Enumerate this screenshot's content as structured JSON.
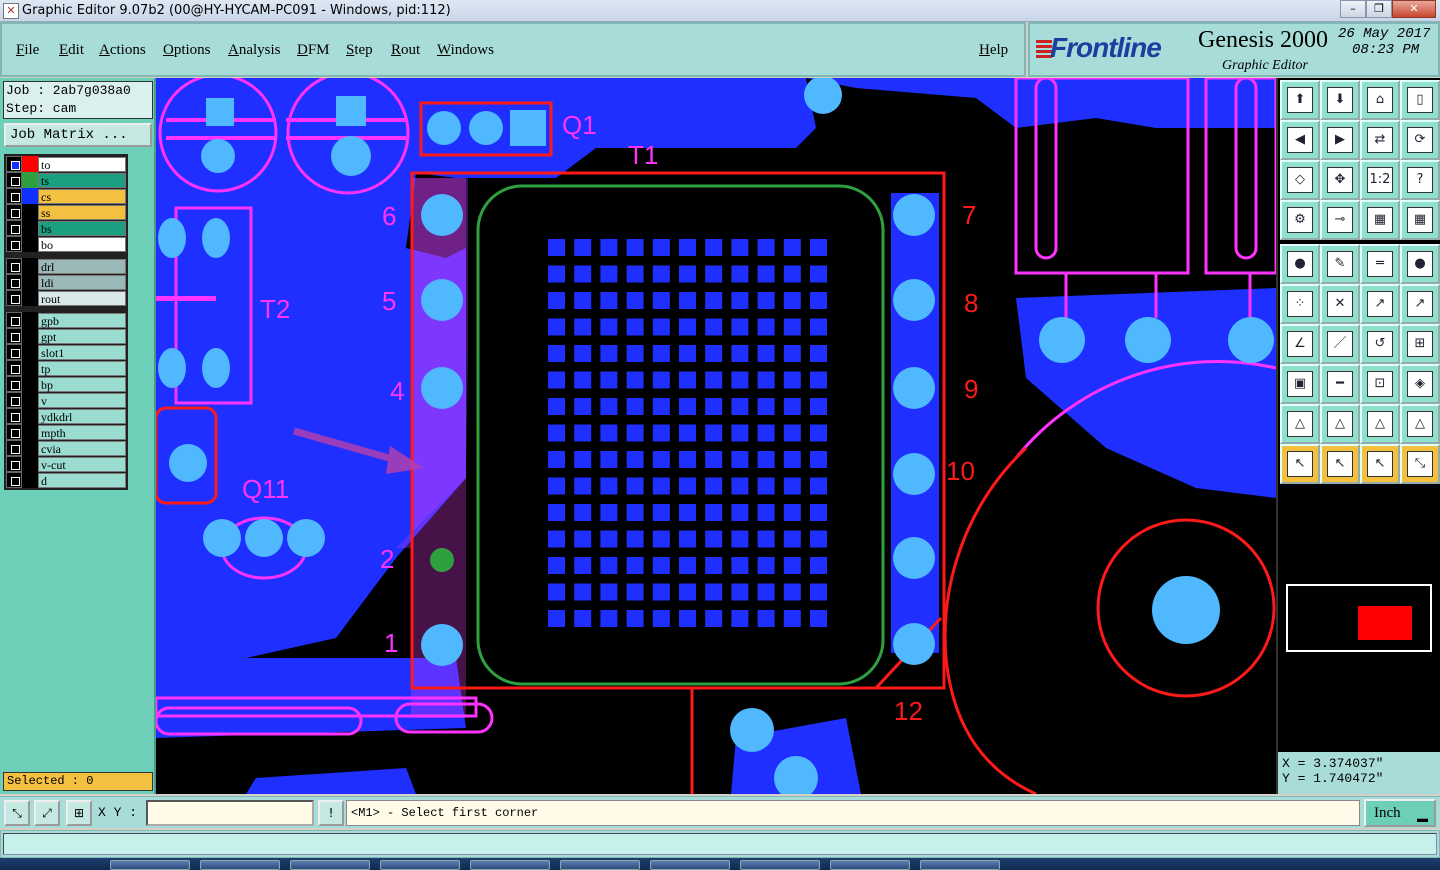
{
  "window": {
    "title": "Graphic Editor 9.07b2 (00@HY-HYCAM-PC091 - Windows, pid:112)",
    "min": "–",
    "max": "❐",
    "close": "✕"
  },
  "menu": [
    "File",
    "Edit",
    "Actions",
    "Options",
    "Analysis",
    "DFM",
    "Step",
    "Rout",
    "Windows"
  ],
  "help": "Help",
  "brand": {
    "logo": "Frontline",
    "product": "Genesis 2000",
    "subtitle": "Graphic Editor",
    "date": "26 May 2017",
    "time": "08:23 PM"
  },
  "job": {
    "job_line": "Job : 2ab7g038a0",
    "step_line": "Step: cam",
    "matrix_button": "Job Matrix ..."
  },
  "layers_group1": [
    {
      "name": "to",
      "color": "#ff0000",
      "bg": "#ffffff",
      "active": true
    },
    {
      "name": "ts",
      "color": "#2fa040",
      "bg": "#1aa080"
    },
    {
      "name": "cs",
      "color": "#1030ff",
      "bg": "#f4c040"
    },
    {
      "name": "ss",
      "color": "#000000",
      "bg": "#f4c040"
    },
    {
      "name": "bs",
      "color": "#000000",
      "bg": "#1aa080"
    },
    {
      "name": "bo",
      "color": "#000000",
      "bg": "#ffffff"
    }
  ],
  "layers_group2": [
    {
      "name": "drl",
      "bg": "#9ab8b8"
    },
    {
      "name": "ldi",
      "bg": "#9ab8b8"
    },
    {
      "name": "rout",
      "bg": "#d8e8e8"
    }
  ],
  "layers_group3": [
    {
      "name": "gpb"
    },
    {
      "name": "gpt"
    },
    {
      "name": "slot1"
    },
    {
      "name": "tp"
    },
    {
      "name": "bp"
    },
    {
      "name": "v"
    },
    {
      "name": "ydkdrl"
    },
    {
      "name": "mpth"
    },
    {
      "name": "cvia"
    },
    {
      "name": "v-cut"
    },
    {
      "name": "d"
    }
  ],
  "selected": "Selected : 0",
  "toolbar_icons": [
    "zoom-in-icon",
    "zoom-out-icon",
    "home-icon",
    "split-icon",
    "pan-left-icon",
    "pan-right-icon",
    "swap-icon",
    "redraw-icon",
    "fit-icon",
    "center-icon",
    "ratio-icon",
    "help-icon",
    "measure-icon",
    "snap-icon",
    "layers-a-icon",
    "layers-b-icon",
    "pad-icon",
    "edit-shape-icon",
    "ruler-icon",
    "dot-icon",
    "net-icon",
    "cross-icon",
    "move-icon",
    "copy-icon",
    "line-icon",
    "slash-icon",
    "undo-icon",
    "feature-icon",
    "select-box-icon",
    "minus-icon",
    "resize-icon",
    "group-icon",
    "tri-a-icon",
    "tri-b-icon",
    "tri-c-icon",
    "tri-d-icon",
    "pointer-icon",
    "select-icon",
    "rotate-icon",
    "route-icon"
  ],
  "toolbar_glyphs": [
    "⬆",
    "⬇",
    "⌂",
    "▯",
    "◀",
    "▶",
    "⇄",
    "⟳",
    "◇",
    "✥",
    "1:2",
    "?",
    "⚙",
    "⊸",
    "▦",
    "▦",
    "●",
    "✎",
    "═",
    "●",
    "⁘",
    "✕",
    "↗",
    "↗",
    "∠",
    "／",
    "↺",
    "⊞",
    "▣",
    "━",
    "⊡",
    "◈",
    "△",
    "△",
    "△",
    "△",
    "↖",
    "↖",
    "↖",
    "⤡"
  ],
  "coords": {
    "x": "X = 3.374037\"",
    "y": "Y = 1.740472\""
  },
  "status": {
    "xy_label": "X Y :",
    "xy_value": "",
    "prompt": "<M1> - Select first corner",
    "unit": "Inch"
  },
  "silkscreen": {
    "q1": "Q1",
    "t1": "T1",
    "t2": "T2",
    "q11": "Q11",
    "pin6": "6",
    "pin5": "5",
    "pin4": "4",
    "pin2": "2",
    "pin1": "1",
    "pin7": "7",
    "pin8": "8",
    "pin9": "9",
    "pin10": "10",
    "pin12": "12"
  }
}
